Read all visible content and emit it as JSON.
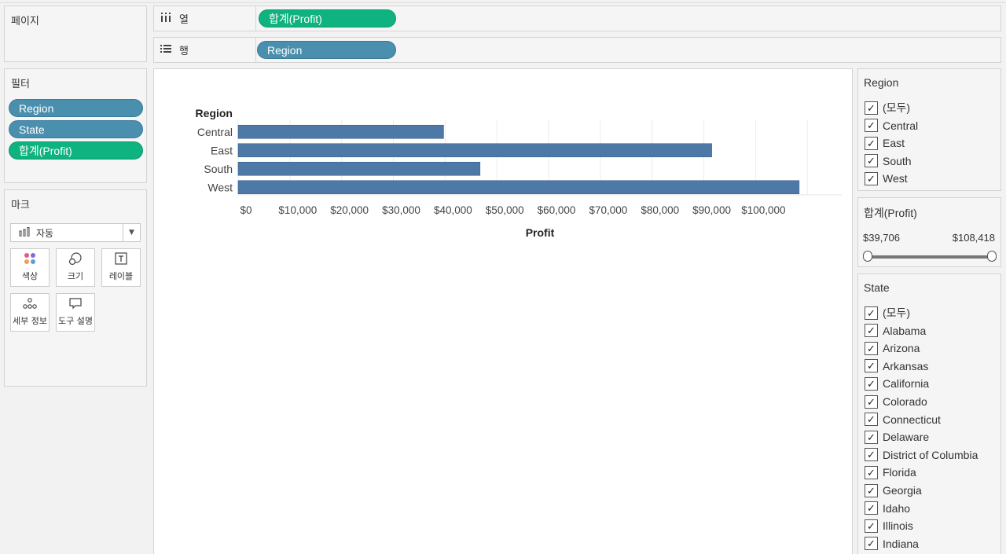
{
  "pages": {
    "title": "페이지"
  },
  "shelves": {
    "columns": {
      "label": "열",
      "icon": "columns-icon",
      "pill": "합계(Profit)"
    },
    "rows": {
      "label": "행",
      "icon": "rows-icon",
      "pill": "Region"
    }
  },
  "filters": {
    "title": "필터",
    "items": [
      {
        "label": "Region",
        "color": "#4a8fad"
      },
      {
        "label": "State",
        "color": "#4a8fad"
      },
      {
        "label": "합계(Profit)",
        "color": "#0fb37f"
      }
    ]
  },
  "marks": {
    "title": "마크",
    "type_select": "자동",
    "buttons": [
      {
        "label": "색상",
        "icon": "color-icon"
      },
      {
        "label": "크기",
        "icon": "size-icon"
      },
      {
        "label": "레이블",
        "icon": "label-icon"
      },
      {
        "label": "세부 정보",
        "icon": "detail-icon"
      },
      {
        "label": "도구 설명",
        "icon": "tooltip-icon"
      }
    ]
  },
  "chart_data": {
    "type": "bar",
    "orientation": "horizontal",
    "row_header": "Region",
    "categories": [
      "Central",
      "East",
      "South",
      "West"
    ],
    "values": [
      39706,
      91523,
      46749,
      108418
    ],
    "xlabel": "Profit",
    "xlim": [
      0,
      113000
    ],
    "x_ticks": [
      0,
      10000,
      20000,
      30000,
      40000,
      50000,
      60000,
      70000,
      80000,
      90000,
      100000
    ],
    "x_tick_labels": [
      "$0",
      "$10,000",
      "$20,000",
      "$30,000",
      "$40,000",
      "$50,000",
      "$60,000",
      "$70,000",
      "$80,000",
      "$90,000",
      "$100,000"
    ],
    "bar_color": "#4e79a7",
    "grid": true
  },
  "region_filter": {
    "title": "Region",
    "items": [
      "(모두)",
      "Central",
      "East",
      "South",
      "West"
    ]
  },
  "profit_filter": {
    "title": "합계(Profit)",
    "min": "$39,706",
    "max": "$108,418"
  },
  "state_filter": {
    "title": "State",
    "items": [
      "(모두)",
      "Alabama",
      "Arizona",
      "Arkansas",
      "California",
      "Colorado",
      "Connecticut",
      "Delaware",
      "District of Columbia",
      "Florida",
      "Georgia",
      "Idaho",
      "Illinois",
      "Indiana"
    ]
  }
}
